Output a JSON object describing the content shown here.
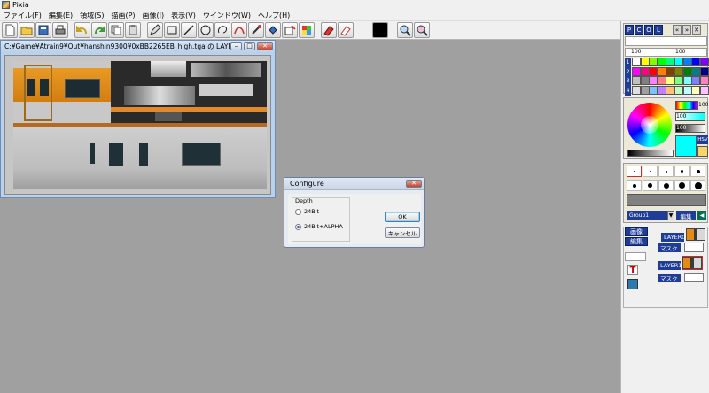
{
  "app": {
    "title": "Pixia"
  },
  "menu": [
    "ファイル(F)",
    "編集(E)",
    "領域(S)",
    "描画(P)",
    "画像(I)",
    "表示(V)",
    "ウインドウ(W)",
    "ヘルプ(H)"
  ],
  "toolbar_icons": [
    "new-icon",
    "open-icon",
    "save-icon",
    "print-icon",
    "undo-icon",
    "redo-icon",
    "copy-icon",
    "paste-icon",
    "pen-icon",
    "rect-icon",
    "line-icon",
    "ellipse-icon",
    "lasso-icon",
    "curve-icon",
    "magic-wand-icon",
    "fill-icon",
    "select-icon",
    "mosaic-icon",
    "eraser-red-icon",
    "eraser-icon",
    "color-swatch-icon",
    "zoom-in-icon",
    "zoom-out-icon"
  ],
  "document": {
    "title": "C:¥Game¥Atrain9¥Out¥hanshin9300¥0xBB2265EB_high.tga の LAYER1"
  },
  "dialog": {
    "title": "Configure",
    "group_label": "Depth",
    "options": [
      "24Bit",
      "24Bit+ALPHA"
    ],
    "selected": "24Bit+ALPHA",
    "ok_label": "OK",
    "cancel_label": "キャンセル"
  },
  "palette": {
    "header_buttons": [
      "P",
      "C",
      "O",
      "L"
    ],
    "row_labels": [
      "1",
      "2",
      "3",
      "4"
    ],
    "size_values": [
      "100",
      "100"
    ],
    "colors": [
      [
        "#ffffff",
        "#ffff00",
        "#80ff00",
        "#00ff00",
        "#00ff80",
        "#00ffff",
        "#0080ff",
        "#0000ff",
        "#8000ff"
      ],
      [
        "#ff00ff",
        "#ff0080",
        "#ff0000",
        "#ff8000",
        "#804000",
        "#808000",
        "#008000",
        "#008080",
        "#000080"
      ],
      [
        "#c0c0c0",
        "#808080",
        "#ff80ff",
        "#ff8080",
        "#ffff80",
        "#80ff80",
        "#80ffff",
        "#8080ff",
        "#ff80c0"
      ],
      [
        "#e0e0e0",
        "#a0a0a0",
        "#80c0ff",
        "#c080ff",
        "#ffc080",
        "#c0ffc0",
        "#c0ffff",
        "#ffffc0",
        "#ffc0ff"
      ]
    ]
  },
  "color_picker": {
    "values": [
      "100",
      "100",
      "100"
    ],
    "mode_label": "HSV",
    "current_color": "#00ffff"
  },
  "brush": {
    "group_label": "Group1",
    "edit_label": "編集"
  },
  "layers": {
    "image_tab": "画像",
    "edit_tab": "編集",
    "items": [
      {
        "name": "LAYER0",
        "mask": "マスク"
      },
      {
        "name": "LAYER1",
        "mask": "マスク"
      }
    ]
  }
}
